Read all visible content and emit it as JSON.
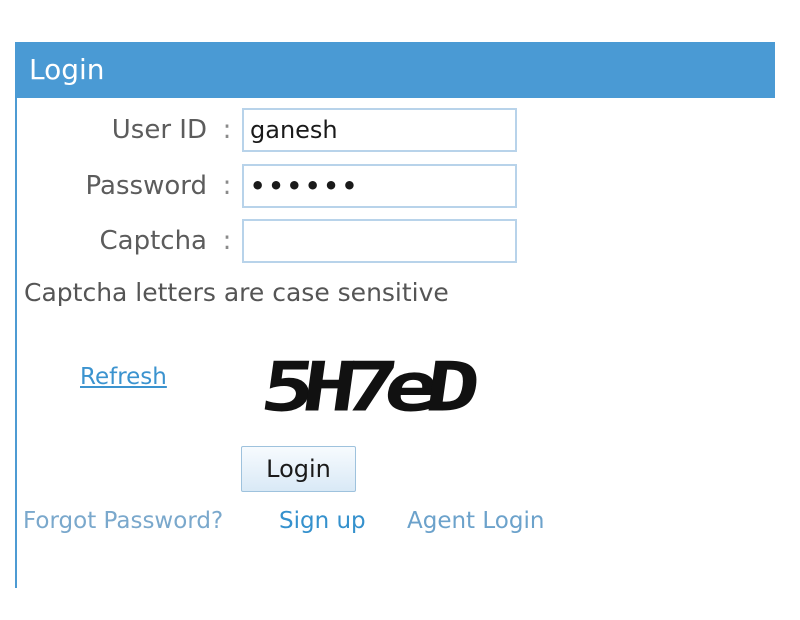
{
  "panel": {
    "title": "Login"
  },
  "form": {
    "fields": [
      {
        "label": "User ID",
        "colon": ":",
        "value": "ganesh"
      },
      {
        "label": "Password",
        "colon": ":",
        "value": "••••••"
      },
      {
        "label": "Captcha",
        "colon": ":",
        "value": ""
      }
    ],
    "hint": "Captcha letters are case sensitive",
    "refresh_label": "Refresh",
    "captcha_text": "5H7eD",
    "submit_label": "Login"
  },
  "links": {
    "forgot_password": "Forgot Password?",
    "sign_up": "Sign up",
    "agent_login": "Agent Login"
  },
  "colors": {
    "header_bg": "#4a9ad4",
    "link": "#3b93cf",
    "field_border": "#b8d3ea"
  }
}
